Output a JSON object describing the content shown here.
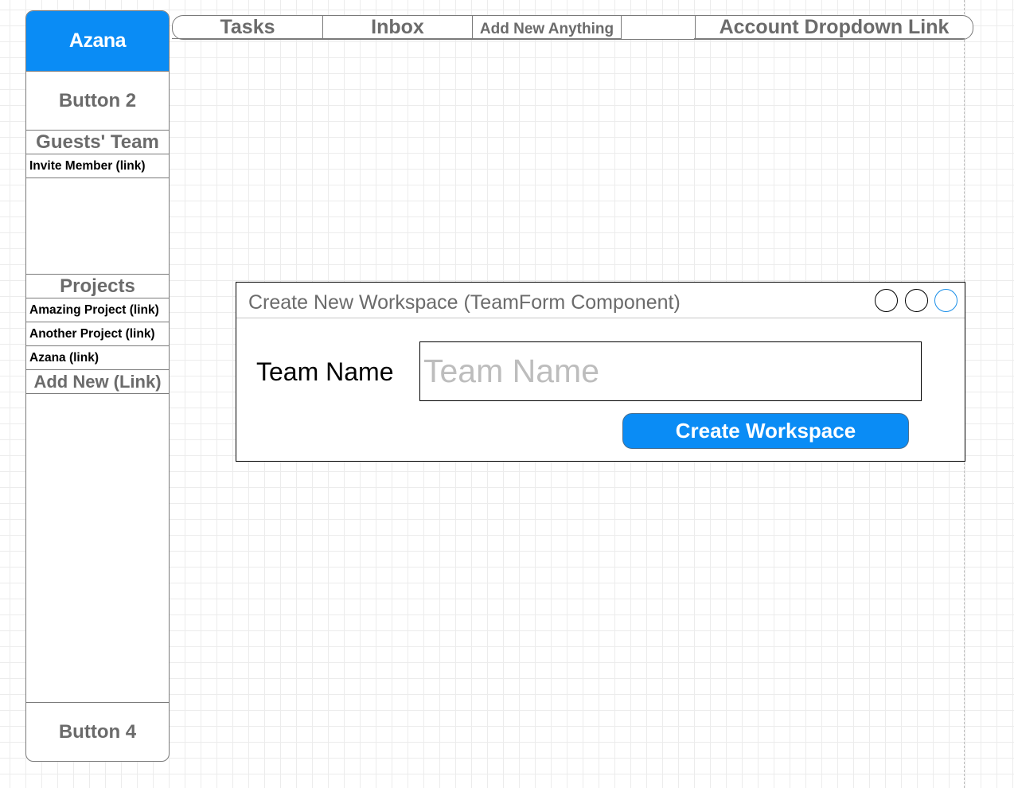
{
  "sidebar": {
    "brand": "Azana",
    "button2": "Button 2",
    "team_header": "Guests' Team",
    "invite_link": "Invite Member (link)",
    "projects_header": "Projects",
    "projects": [
      {
        "label": "Amazing Project (link)"
      },
      {
        "label": "Another Project (link)"
      },
      {
        "label": "Azana (link)"
      }
    ],
    "add_new": "Add New (Link)",
    "button4": "Button 4"
  },
  "topnav": {
    "tabs": [
      {
        "label": "Tasks"
      },
      {
        "label": "Inbox"
      },
      {
        "label": "Add New Anything"
      },
      {
        "label": ""
      },
      {
        "label": "Account Dropdown Link"
      }
    ]
  },
  "modal": {
    "title": "Create New Workspace (TeamForm Component)",
    "form": {
      "label": "Team Name",
      "placeholder": "Team Name",
      "value": ""
    },
    "submit_label": "Create Workspace",
    "window_controls": [
      "circle-icon",
      "circle-icon",
      "circle-icon"
    ],
    "accent_color": "#0a8cf5"
  }
}
